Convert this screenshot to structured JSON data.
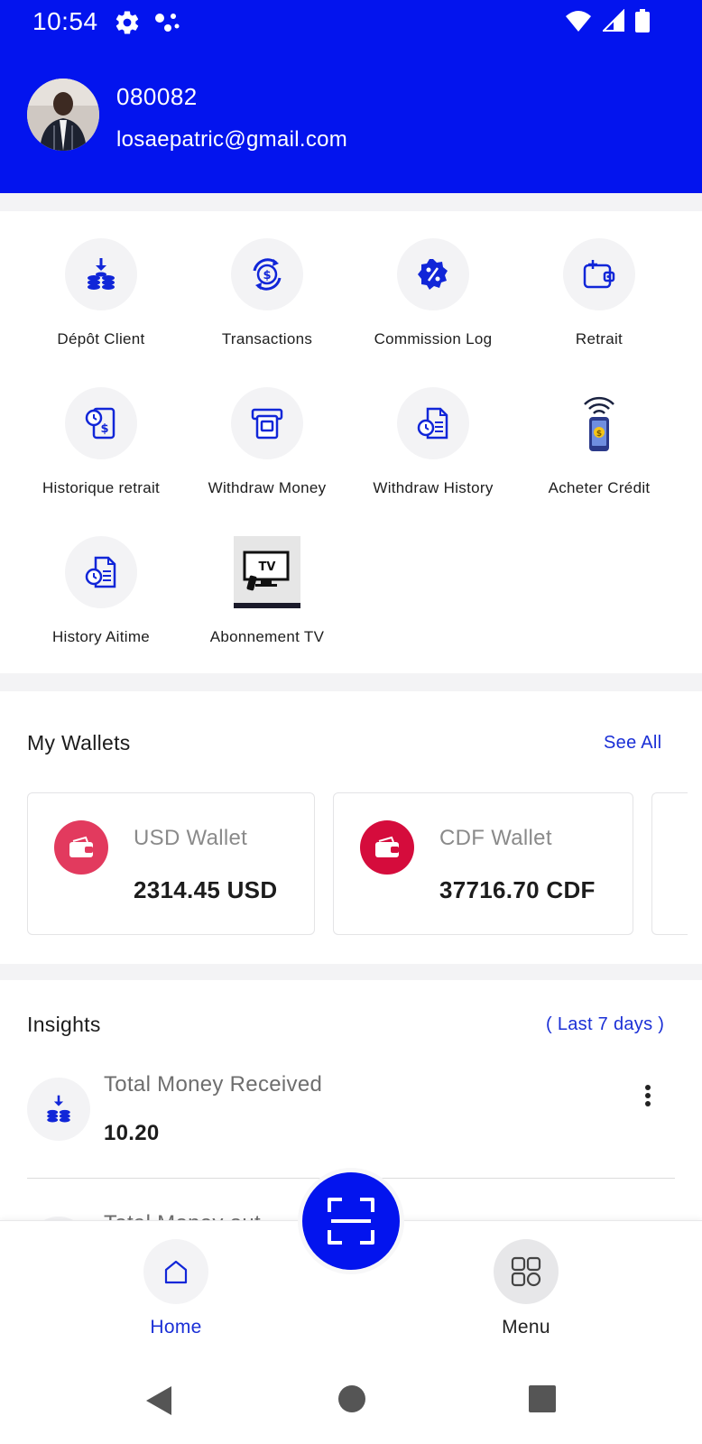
{
  "status_bar": {
    "time": "10:54",
    "icons": [
      "gear-icon",
      "assistant-dots-icon",
      "wifi-icon",
      "signal-icon",
      "battery-icon"
    ]
  },
  "profile": {
    "user_id": "080082",
    "email": "losaepatric@gmail.com"
  },
  "services": [
    {
      "label": "Dépôt Client",
      "icon": "deposit-coins-icon"
    },
    {
      "label": "Transactions",
      "icon": "transactions-cycle-icon"
    },
    {
      "label": "Commission Log",
      "icon": "commission-badge-icon"
    },
    {
      "label": "Retrait",
      "icon": "wallet-withdraw-icon"
    },
    {
      "label": "Historique retrait",
      "icon": "withdraw-history-receipt-icon"
    },
    {
      "label": "Withdraw Money",
      "icon": "atm-icon"
    },
    {
      "label": "Withdraw History",
      "icon": "history-document-icon"
    },
    {
      "label": "Acheter Crédit",
      "icon": "phone-credit-icon"
    },
    {
      "label": "History Aitime",
      "icon": "history-document-icon"
    },
    {
      "label": "Abonnement TV",
      "icon": "tv-icon",
      "icon_text": "TV"
    }
  ],
  "wallets": {
    "title": "My Wallets",
    "see_all": "See All",
    "items": [
      {
        "name": "USD Wallet",
        "amount": "2314.45 USD",
        "color": "#e23a5e"
      },
      {
        "name": "CDF Wallet",
        "amount": "37716.70 CDF",
        "color": "#d50c3c"
      }
    ]
  },
  "insights": {
    "title": "Insights",
    "period": "( Last 7 days )",
    "items": [
      {
        "label": "Total Money Received",
        "value": "10.20"
      },
      {
        "label": "Total Money out",
        "value": ""
      }
    ]
  },
  "bottom_nav": {
    "home": "Home",
    "menu": "Menu"
  },
  "colors": {
    "primary": "#0314ee",
    "link": "#1a2fd6"
  }
}
